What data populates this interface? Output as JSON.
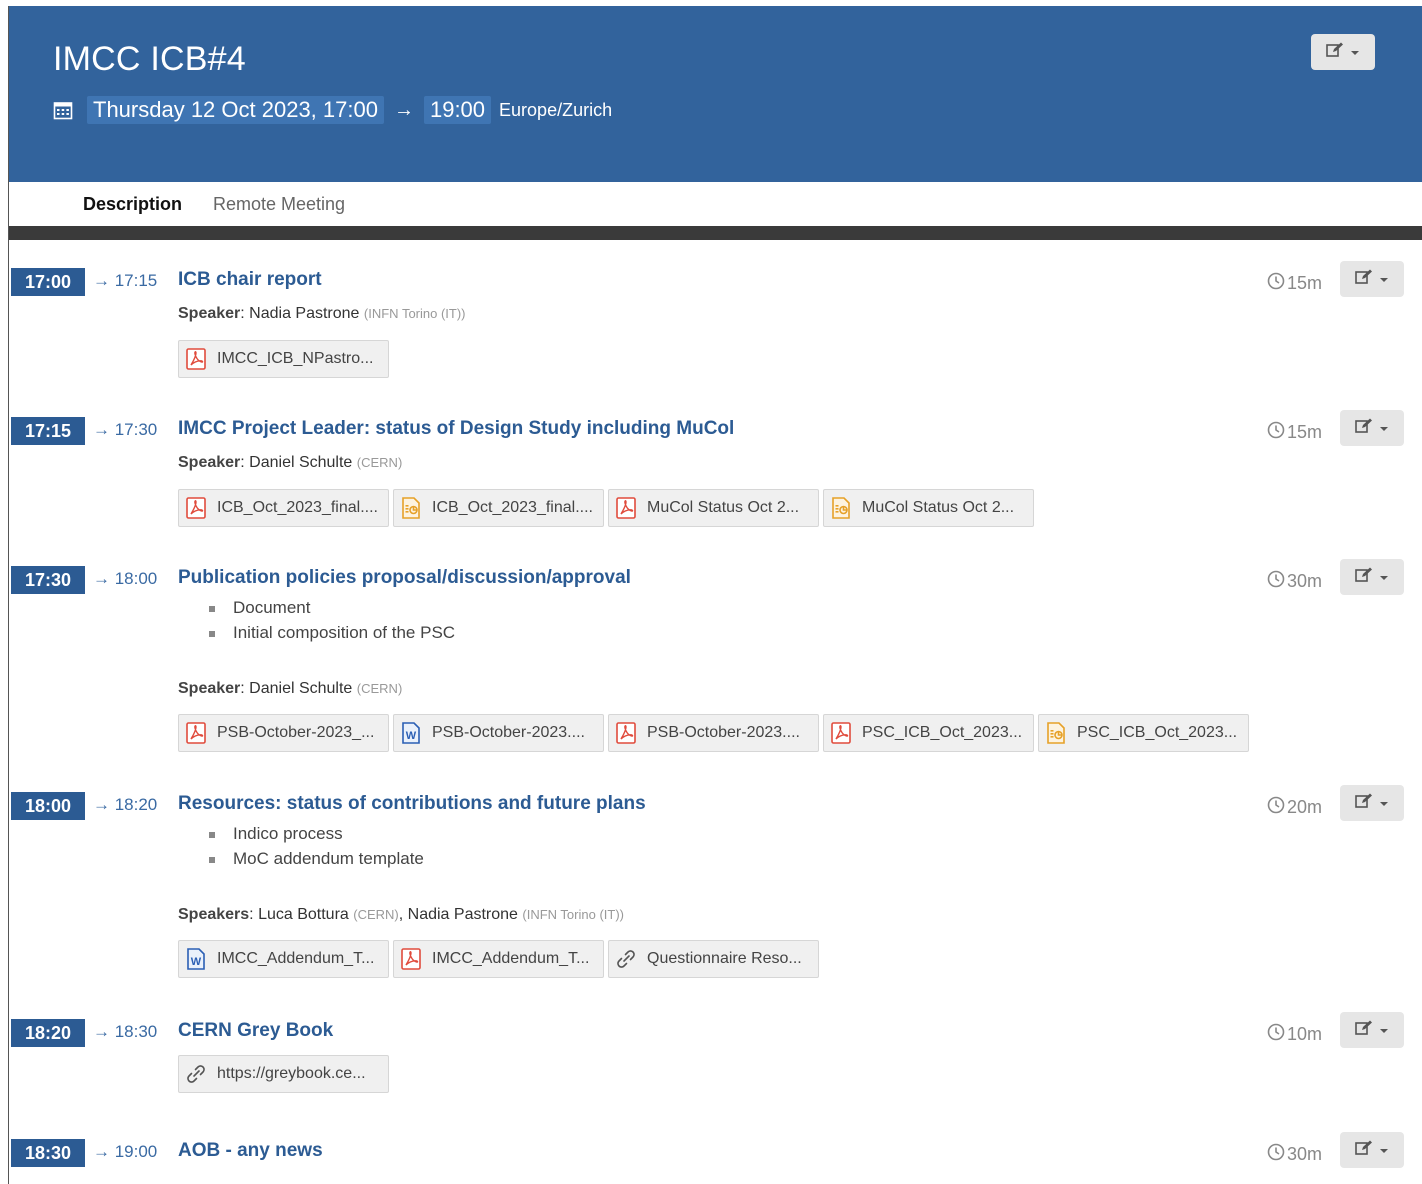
{
  "event": {
    "title": "IMCC ICB#4",
    "date_start": "Thursday 12 Oct 2023, 17:00",
    "arrow": "→",
    "time_end": "19:00",
    "timezone": "Europe/Zurich"
  },
  "tabs": {
    "description": "Description",
    "remote": "Remote Meeting"
  },
  "labels": {
    "speaker": "Speaker",
    "speakers": "Speakers"
  },
  "icons": {
    "calendar": "calendar-icon",
    "edit": "edit-icon",
    "caret": "caret-down-icon",
    "clock": "clock-icon",
    "pdf": "pdf-file-icon",
    "ppt": "presentation-file-icon",
    "word": "word-file-icon",
    "link": "link-icon"
  },
  "colors": {
    "header_bg": "#32639c",
    "accent": "#2c5b93",
    "pdf": "#e04b3c",
    "ppt": "#e6a128",
    "word": "#2b5fb4"
  },
  "entries": [
    {
      "start": "17:00",
      "end": "→ 17:15",
      "title": "ICB chair report",
      "duration": "15m",
      "speakers": [
        {
          "name": "Nadia Pastrone",
          "aff": "(INFN Torino (IT))"
        }
      ],
      "files": [
        {
          "type": "pdf",
          "name": "IMCC_ICB_NPastro..."
        }
      ]
    },
    {
      "start": "17:15",
      "end": "→ 17:30",
      "title": "IMCC Project Leader: status of Design Study including MuCol",
      "duration": "15m",
      "speakers": [
        {
          "name": "Daniel Schulte",
          "aff": "(CERN)"
        }
      ],
      "files": [
        {
          "type": "pdf",
          "name": "ICB_Oct_2023_final...."
        },
        {
          "type": "ppt",
          "name": "ICB_Oct_2023_final...."
        },
        {
          "type": "pdf",
          "name": "MuCol Status Oct 2..."
        },
        {
          "type": "ppt",
          "name": "MuCol Status Oct 2..."
        }
      ]
    },
    {
      "start": "17:30",
      "end": "→ 18:00",
      "title": "Publication policies proposal/discussion/approval",
      "duration": "30m",
      "bullets": [
        "Document",
        "Initial composition of the PSC"
      ],
      "speakers": [
        {
          "name": "Daniel Schulte",
          "aff": "(CERN)"
        }
      ],
      "files": [
        {
          "type": "pdf",
          "name": "PSB-October-2023_..."
        },
        {
          "type": "word",
          "name": "PSB-October-2023...."
        },
        {
          "type": "pdf",
          "name": "PSB-October-2023...."
        },
        {
          "type": "pdf",
          "name": "PSC_ICB_Oct_2023..."
        },
        {
          "type": "ppt",
          "name": "PSC_ICB_Oct_2023..."
        }
      ]
    },
    {
      "start": "18:00",
      "end": "→ 18:20",
      "title": "Resources: status of contributions and future plans",
      "duration": "20m",
      "bullets": [
        "Indico process",
        "MoC addendum template"
      ],
      "speakers": [
        {
          "name": "Luca Bottura",
          "aff": "(CERN)"
        },
        {
          "name": "Nadia Pastrone",
          "aff": "(INFN Torino (IT))"
        }
      ],
      "files": [
        {
          "type": "word",
          "name": "IMCC_Addendum_T..."
        },
        {
          "type": "pdf",
          "name": "IMCC_Addendum_T..."
        },
        {
          "type": "link",
          "name": "Questionnaire Reso..."
        }
      ]
    },
    {
      "start": "18:20",
      "end": "→ 18:30",
      "title": "CERN Grey Book",
      "duration": "10m",
      "files": [
        {
          "type": "link",
          "name": "https://greybook.ce..."
        }
      ]
    },
    {
      "start": "18:30",
      "end": "→ 19:00",
      "title": "AOB - any news",
      "duration": "30m"
    }
  ]
}
